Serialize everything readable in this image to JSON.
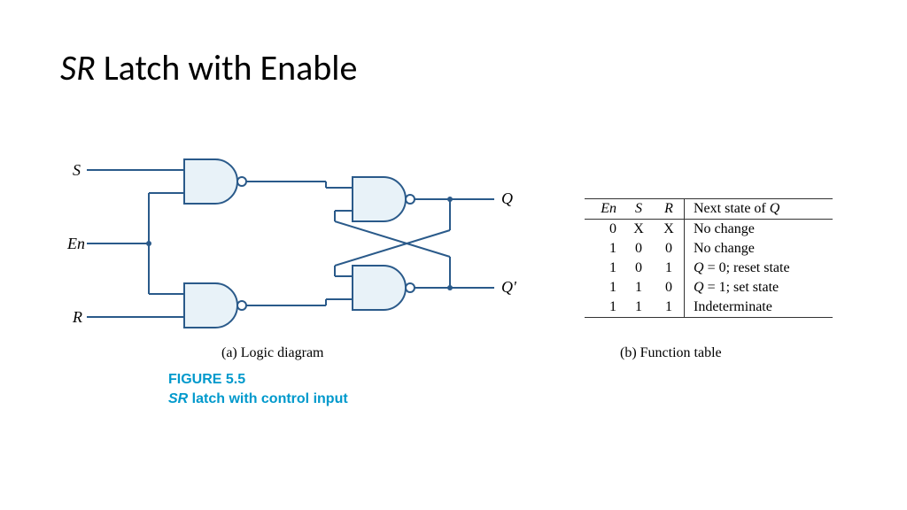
{
  "title_prefix": "SR",
  "title_rest": " Latch with Enable",
  "diagram": {
    "inputs": {
      "S": "S",
      "En": "En",
      "R": "R"
    },
    "outputs": {
      "Q": "Q",
      "Qp": "Q'"
    },
    "caption_a": "(a) Logic diagram"
  },
  "figure": {
    "number": "FIGURE 5.5",
    "title_prefix": "SR",
    "title_rest": " latch with control input"
  },
  "table": {
    "headers": {
      "En": "En",
      "S": "S",
      "R": "R",
      "Next": "Next state of Q"
    },
    "rows": [
      {
        "en": "0",
        "s": "X",
        "r": "X",
        "next": "No change"
      },
      {
        "en": "1",
        "s": "0",
        "r": "0",
        "next": "No change"
      },
      {
        "en": "1",
        "s": "0",
        "r": "1",
        "next": "Q = 0; reset state"
      },
      {
        "en": "1",
        "s": "1",
        "r": "0",
        "next": "Q = 1; set state"
      },
      {
        "en": "1",
        "s": "1",
        "r": "1",
        "next": "Indeterminate"
      }
    ],
    "caption_b": "(b) Function table"
  }
}
